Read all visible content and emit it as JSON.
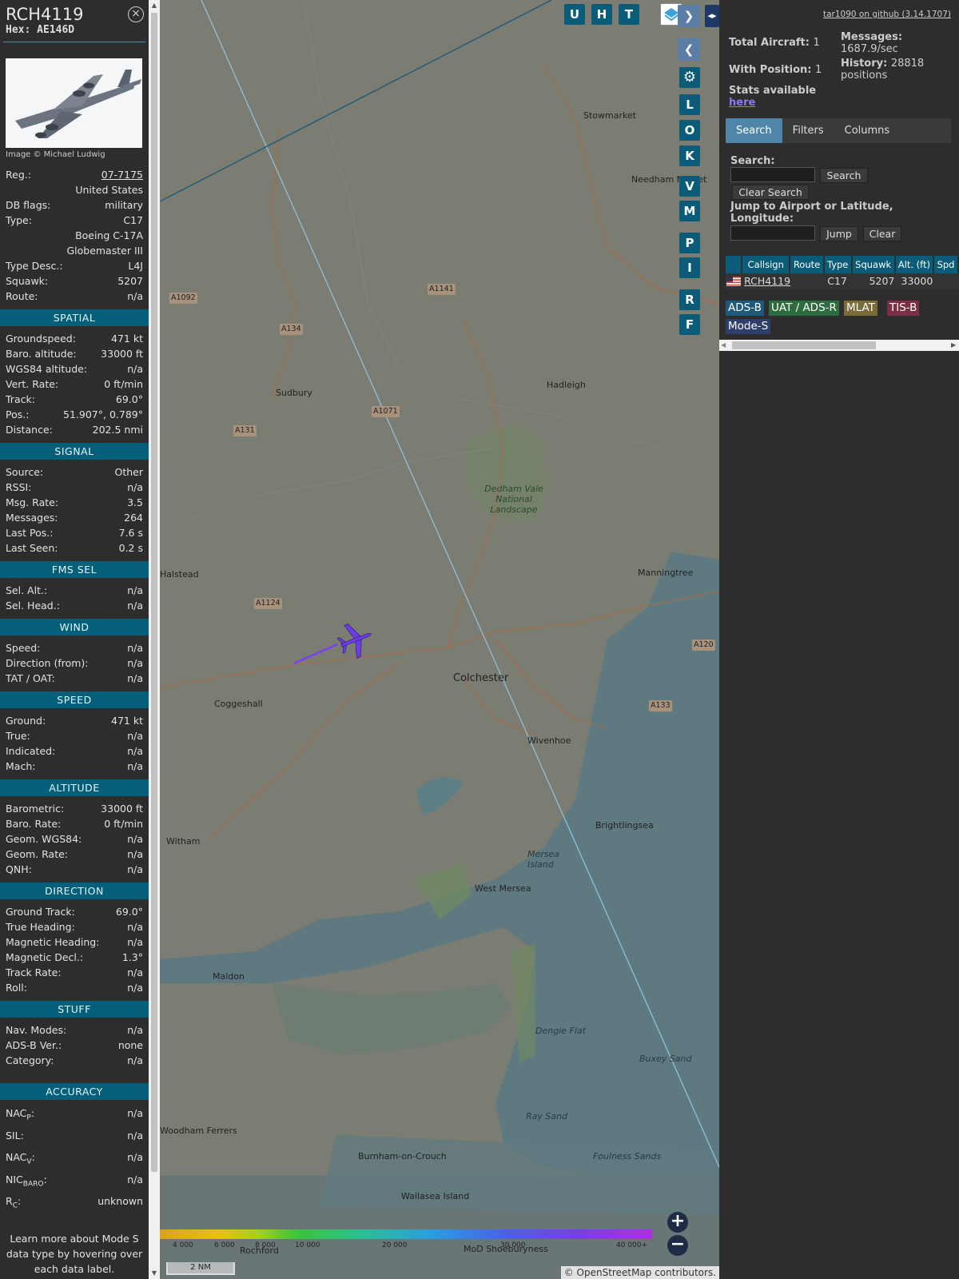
{
  "sidebar": {
    "callsign": "RCH4119",
    "hex_label": "Hex:",
    "hex": "AE146D",
    "close_glyph": "×",
    "photo_credit": "Image © Michael Ludwig",
    "info": [
      {
        "label": "Reg.:",
        "value": "07-7175",
        "link": true
      },
      {
        "label": "",
        "value": "United States"
      },
      {
        "label": "DB flags:",
        "value": "military"
      },
      {
        "label": "Type:",
        "value": "C17"
      },
      {
        "label": "",
        "value": "Boeing C-17A Globemaster III"
      },
      {
        "label": "Type Desc.:",
        "value": "L4J"
      },
      {
        "label": "Squawk:",
        "value": "5207"
      },
      {
        "label": "Route:",
        "value": "n/a"
      }
    ],
    "sections": [
      {
        "title": "SPATIAL",
        "rows": [
          {
            "label": "Groundspeed:",
            "value": "471 kt"
          },
          {
            "label": "Baro. altitude:",
            "value": "33000 ft"
          },
          {
            "label": "WGS84 altitude:",
            "value": "n/a"
          },
          {
            "label": "Vert. Rate:",
            "value": "0 ft/min"
          },
          {
            "label": "Track:",
            "value": "69.0°"
          },
          {
            "label": "Pos.:",
            "value": "51.907°, 0.789°"
          },
          {
            "label": "Distance:",
            "value": "202.5 nmi"
          }
        ]
      },
      {
        "title": "SIGNAL",
        "rows": [
          {
            "label": "Source:",
            "value": "Other"
          },
          {
            "label": "RSSI:",
            "value": "n/a"
          },
          {
            "label": "Msg. Rate:",
            "value": "3.5"
          },
          {
            "label": "Messages:",
            "value": "264"
          },
          {
            "label": "Last Pos.:",
            "value": "7.6 s"
          },
          {
            "label": "Last Seen:",
            "value": "0.2 s"
          }
        ]
      },
      {
        "title": "FMS SEL",
        "rows": [
          {
            "label": "Sel. Alt.:",
            "value": "n/a"
          },
          {
            "label": "Sel. Head.:",
            "value": "n/a"
          }
        ]
      },
      {
        "title": "WIND",
        "rows": [
          {
            "label": "Speed:",
            "value": "n/a"
          },
          {
            "label": "Direction (from):",
            "value": "n/a"
          },
          {
            "label": "TAT / OAT:",
            "value": "n/a"
          }
        ]
      },
      {
        "title": "SPEED",
        "rows": [
          {
            "label": "Ground:",
            "value": "471 kt"
          },
          {
            "label": "True:",
            "value": "n/a"
          },
          {
            "label": "Indicated:",
            "value": "n/a"
          },
          {
            "label": "Mach:",
            "value": "n/a"
          }
        ]
      },
      {
        "title": "ALTITUDE",
        "rows": [
          {
            "label": "Barometric:",
            "value": "33000 ft"
          },
          {
            "label": "Baro. Rate:",
            "value": "0 ft/min"
          },
          {
            "label": "Geom. WGS84:",
            "value": "n/a"
          },
          {
            "label": "Geom. Rate:",
            "value": "n/a"
          },
          {
            "label": "QNH:",
            "value": "n/a"
          }
        ]
      },
      {
        "title": "DIRECTION",
        "rows": [
          {
            "label": "Ground Track:",
            "value": "69.0°"
          },
          {
            "label": "True Heading:",
            "value": "n/a"
          },
          {
            "label": "Magnetic Heading:",
            "value": "n/a"
          },
          {
            "label": "Magnetic Decl.:",
            "value": "1.3°"
          },
          {
            "label": "Track Rate:",
            "value": "n/a"
          },
          {
            "label": "Roll:",
            "value": "n/a"
          }
        ]
      },
      {
        "title": "STUFF",
        "rows": [
          {
            "label": "Nav. Modes:",
            "value": "n/a"
          },
          {
            "label": "ADS-B Ver.:",
            "value": "none"
          },
          {
            "label": "Category:",
            "value": "n/a"
          }
        ]
      }
    ],
    "accuracy": {
      "title": "ACCURACY",
      "rows": [
        {
          "label": "NAC",
          "sub": "P",
          "suffix": ":",
          "value": "n/a"
        },
        {
          "label": "SIL:",
          "sub": "",
          "suffix": "",
          "value": "n/a"
        },
        {
          "label": "NAC",
          "sub": "V",
          "suffix": ":",
          "value": "n/a"
        },
        {
          "label": "NIC",
          "sub": "BARO",
          "suffix": ":",
          "value": "n/a"
        },
        {
          "label": "R",
          "sub": "C",
          "suffix": ":",
          "value": "unknown"
        }
      ]
    },
    "learn_more": "Learn more about Mode S data type by hovering over each data label."
  },
  "map": {
    "buttons_top": [
      "U",
      "H",
      "T"
    ],
    "buttons_side": [
      "L",
      "O",
      "K",
      "V",
      "M",
      "P",
      "I",
      "R",
      "F"
    ],
    "places": [
      {
        "name": "Stowmarket"
      },
      {
        "name": "Needham Market"
      },
      {
        "name": "Hadleigh"
      },
      {
        "name": "Sudbury"
      },
      {
        "name": "Dedham Vale National Landscape"
      },
      {
        "name": "Halstead"
      },
      {
        "name": "Manningtree"
      },
      {
        "name": "Colchester"
      },
      {
        "name": "Coggeshall"
      },
      {
        "name": "Wivenhoe"
      },
      {
        "name": "Brightlingsea"
      },
      {
        "name": "Mersea Island"
      },
      {
        "name": "West Mersea"
      },
      {
        "name": "Witham"
      },
      {
        "name": "Maldon"
      },
      {
        "name": "Dengie Flat"
      },
      {
        "name": "Buxey Sand"
      },
      {
        "name": "Ray Sand"
      },
      {
        "name": "Foulness Sands"
      },
      {
        "name": "Burnham-on-Crouch"
      },
      {
        "name": "Wallasea Island"
      },
      {
        "name": "Woodham Ferrers"
      },
      {
        "name": "MoD Shoeburyness"
      },
      {
        "name": "Rochford"
      }
    ],
    "roads": [
      "A1092",
      "A134",
      "A1141",
      "A1071",
      "A131",
      "A1124",
      "A120",
      "A133"
    ],
    "altitude_scale": [
      "4 000",
      "6 000",
      "8 000",
      "10 000",
      "20 000",
      "30 000",
      "40 000+"
    ],
    "scale_label": "2 NM",
    "attribution": "© OpenStreetMap contributors.",
    "zoom_in": "+",
    "zoom_out": "−"
  },
  "right": {
    "github": "tar1090 on github (3.14.1707)",
    "total_label": "Total Aircraft:",
    "total": "1",
    "withpos_label": "With Position:",
    "withpos": "1",
    "messages_label": "Messages:",
    "messages": "1687.9/sec",
    "history_label": "History:",
    "history": "28818 positions",
    "stats_label": "Stats available",
    "stats_link": "here",
    "tabs": [
      "Search",
      "Filters",
      "Columns"
    ],
    "search_label": "Search:",
    "search_btn": "Search",
    "clear_search_btn": "Clear Search",
    "jump_label": "Jump to Airport or Latitude, Longitude:",
    "jump_btn": "Jump",
    "clear_btn": "Clear",
    "columns": [
      "",
      "Callsign",
      "Route",
      "Type",
      "Squawk",
      "Alt. (ft)",
      "Spd"
    ],
    "rows": [
      {
        "callsign": "RCH4119",
        "route": "",
        "type": "C17",
        "squawk": "5207",
        "alt": "33000",
        "spd": ""
      }
    ],
    "legend": [
      {
        "label": "ADS-B",
        "color": "#1f5a7a"
      },
      {
        "label": "UAT / ADS-R",
        "color": "#2e6b3e"
      },
      {
        "label": "MLAT",
        "color": "#7a6b3a"
      },
      {
        "label": "TIS-B",
        "color": "#7a2f44"
      },
      {
        "label": "Mode-S",
        "color": "#2d3f6a"
      }
    ]
  }
}
